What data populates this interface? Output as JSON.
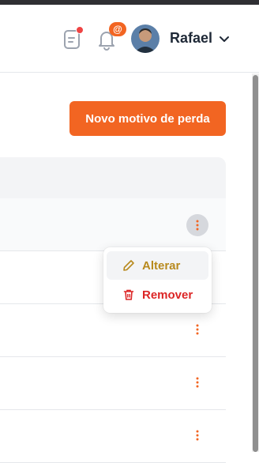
{
  "header": {
    "notes_icon": "notes-icon",
    "notifications_icon": "bell-icon",
    "mention_badge": "@",
    "user": {
      "name": "Rafael",
      "avatar": "avatar-photo"
    }
  },
  "toolbar": {
    "new_button_label": "Novo motivo de perda"
  },
  "table": {
    "rows": [
      {
        "menu_icon": "kebab-icon"
      },
      {
        "menu_icon": "kebab-icon"
      },
      {
        "menu_icon": "kebab-icon"
      },
      {
        "menu_icon": "kebab-icon"
      },
      {
        "menu_icon": "kebab-icon"
      }
    ]
  },
  "context_menu": {
    "items": [
      {
        "label": "Alterar",
        "icon": "pencil-icon"
      },
      {
        "label": "Remover",
        "icon": "trash-icon"
      }
    ]
  },
  "colors": {
    "accent": "#f26522",
    "edit_text": "#b88a1e",
    "remove_text": "#dc2626",
    "notification_dot": "#ef4444"
  }
}
